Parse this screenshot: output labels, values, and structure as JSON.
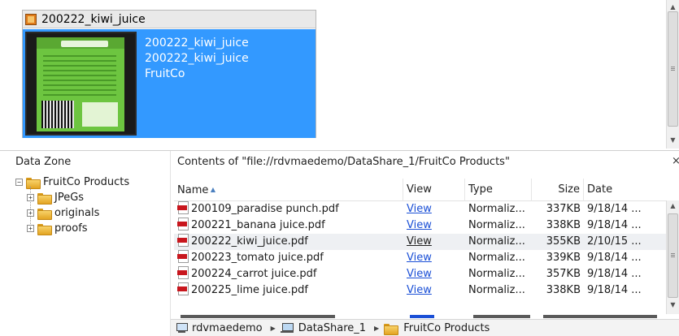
{
  "preview": {
    "title": "200222_kiwi_juice",
    "lines": [
      "200222_kiwi_juice",
      "200222_kiwi_juice",
      "FruitCo"
    ]
  },
  "left_panel": {
    "title": "Data Zone",
    "tree": {
      "root": "FruitCo Products",
      "children": [
        "JPeGs",
        "originals",
        "proofs"
      ]
    }
  },
  "right_panel": {
    "title": "Contents of \"file://rdvmaedemo/DataShare_1/FruitCo Products\"",
    "close": "×",
    "columns": [
      "Name",
      "View",
      "Type",
      "Size",
      "Date"
    ],
    "rows": [
      {
        "name": "200109_paradise punch.pdf",
        "view": "View",
        "type": "Normaliz...",
        "size": "337KB",
        "date": "9/18/14 ..."
      },
      {
        "name": "200221_banana juice.pdf",
        "view": "View",
        "type": "Normaliz...",
        "size": "338KB",
        "date": "9/18/14 ..."
      },
      {
        "name": "200222_kiwi_juice.pdf",
        "view": "View",
        "type": "Normaliz...",
        "size": "355KB",
        "date": "2/10/15 ...",
        "selected": true
      },
      {
        "name": "200223_tomato juice.pdf",
        "view": "View",
        "type": "Normaliz...",
        "size": "339KB",
        "date": "9/18/14 ..."
      },
      {
        "name": "200224_carrot juice.pdf",
        "view": "View",
        "type": "Normaliz...",
        "size": "357KB",
        "date": "9/18/14 ..."
      },
      {
        "name": "200225_lime juice.pdf",
        "view": "View",
        "type": "Normaliz...",
        "size": "338KB",
        "date": "9/18/14 ..."
      }
    ]
  },
  "breadcrumb": [
    "rdvmaedemo",
    "DataShare_1",
    "FruitCo Products"
  ],
  "icons": {
    "preview_doc": "document-icon",
    "folder": "folder-icon",
    "file": "pdf-icon",
    "computer": "computer-icon",
    "network_share": "network-drive-icon"
  },
  "colors": {
    "selection": "#3399ff",
    "link": "#1a4fd6",
    "pdf_red": "#c8161d",
    "folder_yellow": "#f8d36a"
  }
}
